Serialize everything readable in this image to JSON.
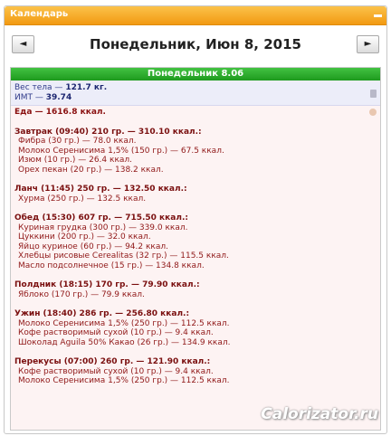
{
  "widget": {
    "title": "Календарь"
  },
  "nav": {
    "prev": "◄",
    "next": "►",
    "date": "Понедельник, Июн 8, 2015"
  },
  "day": {
    "header": "Понедельник 8.06"
  },
  "stats": {
    "weight_label": "Вес тела —",
    "weight_value": "121.7 кг.",
    "bmi_label": "ИМТ —",
    "bmi_value": "39.74"
  },
  "food": {
    "total": "Еда — 1616.8 ккал.",
    "meals": [
      {
        "title": "Завтрак (09:40) 210 гр. — 310.10 ккал.:",
        "items": [
          "Фибра (30 гр.) — 78.0 ккал.",
          "Молоко Серенисима 1,5% (150 гр.) — 67.5 ккал.",
          "Изюм (10 гр.) — 26.4 ккал.",
          "Орех пекан (20 гр.) — 138.2 ккал."
        ]
      },
      {
        "title": "Ланч (11:45) 250 гр. — 132.50 ккал.:",
        "items": [
          "Хурма (250 гр.) — 132.5 ккал."
        ]
      },
      {
        "title": "Обед (15:30) 607 гр. — 715.50 ккал.:",
        "items": [
          "Куриная грудка (300 гр.) — 339.0 ккал.",
          "Цуккини (200 гр.) — 32.0 ккал.",
          "Яйцо куриное (60 гр.) — 94.2 ккал.",
          "Хлебцы рисовые Cerealitas (32 гр.) — 115.5 ккал.",
          "Масло подсолнечное (15 гр.) — 134.8 ккал."
        ]
      },
      {
        "title": "Полдник (18:15) 170 гр. — 79.90 ккал.:",
        "items": [
          "Яблоко (170 гр.) — 79.9 ккал."
        ]
      },
      {
        "title": "Ужин (18:40) 286 гр. — 256.80 ккал.:",
        "items": [
          "Молоко Серенисима 1,5% (250 гр.) — 112.5 ккал.",
          "Кофе растворимый сухой (10 гр.) — 9.4 ккал.",
          "Шоколад Aguila 50% Какао (26 гр.) — 134.9 ккал."
        ]
      },
      {
        "title": "Перекусы (07:00) 260 гр. — 121.90 ккал.:",
        "items": [
          "Кофе растворимый сухой (10 гр.) — 9.4 ккал.",
          "Молоко Серенисима 1,5% (250 гр.) — 112.5 ккал."
        ]
      }
    ]
  },
  "watermark": "Calorizator.ru",
  "icons": {
    "minimize": "minimize-icon",
    "trash": "trash-icon",
    "hand": "hand-icon"
  },
  "colors": {
    "titlebar": "#f29a12",
    "dayheader": "#1e9a1e",
    "foodtext": "#8a1010",
    "statstext": "#2f3a8a"
  }
}
